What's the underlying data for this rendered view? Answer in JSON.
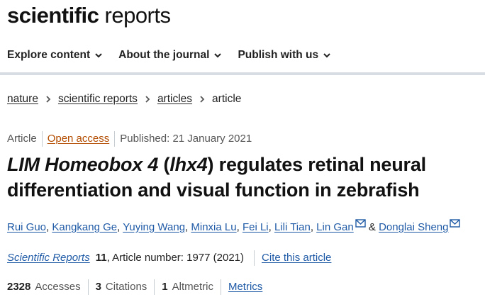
{
  "site": {
    "logo_bold": "scientific",
    "logo_light": "reports"
  },
  "nav": {
    "items": [
      {
        "label": "Explore content"
      },
      {
        "label": "About the journal"
      },
      {
        "label": "Publish with us"
      }
    ]
  },
  "breadcrumb": {
    "items": [
      "nature",
      "scientific reports",
      "articles"
    ],
    "current": "article"
  },
  "meta": {
    "type": "Article",
    "access": "Open access",
    "published": "Published: 21 January 2021"
  },
  "title": {
    "italic_part": "LIM Homeobox 4",
    "paren_open": " (",
    "gene": "lhx4",
    "rest": ") regulates retinal neural differentiation and visual function in zebrafish"
  },
  "authors": [
    "Rui Guo",
    "Kangkang Ge",
    "Yuying Wang",
    "Minxia Lu",
    "Fei Li",
    "Lili Tian",
    "Lin Gan",
    "Donglai Sheng"
  ],
  "authors_sep": ", ",
  "authors_and": " & ",
  "citation": {
    "journal": "Scientific Reports",
    "volume": "11",
    "article_number": ", Article number: 1977 (2021)",
    "cite_link": "Cite this article"
  },
  "metrics": {
    "accesses_count": "2328",
    "accesses_label": "Accesses",
    "citations_count": "3",
    "citations_label": "Citations",
    "altmetric_count": "1",
    "altmetric_label": "Altmetric",
    "metrics_link": "Metrics"
  },
  "colors": {
    "link": "#1f5aa6",
    "open_access": "#b34c00",
    "divider": "#d7dde3"
  }
}
